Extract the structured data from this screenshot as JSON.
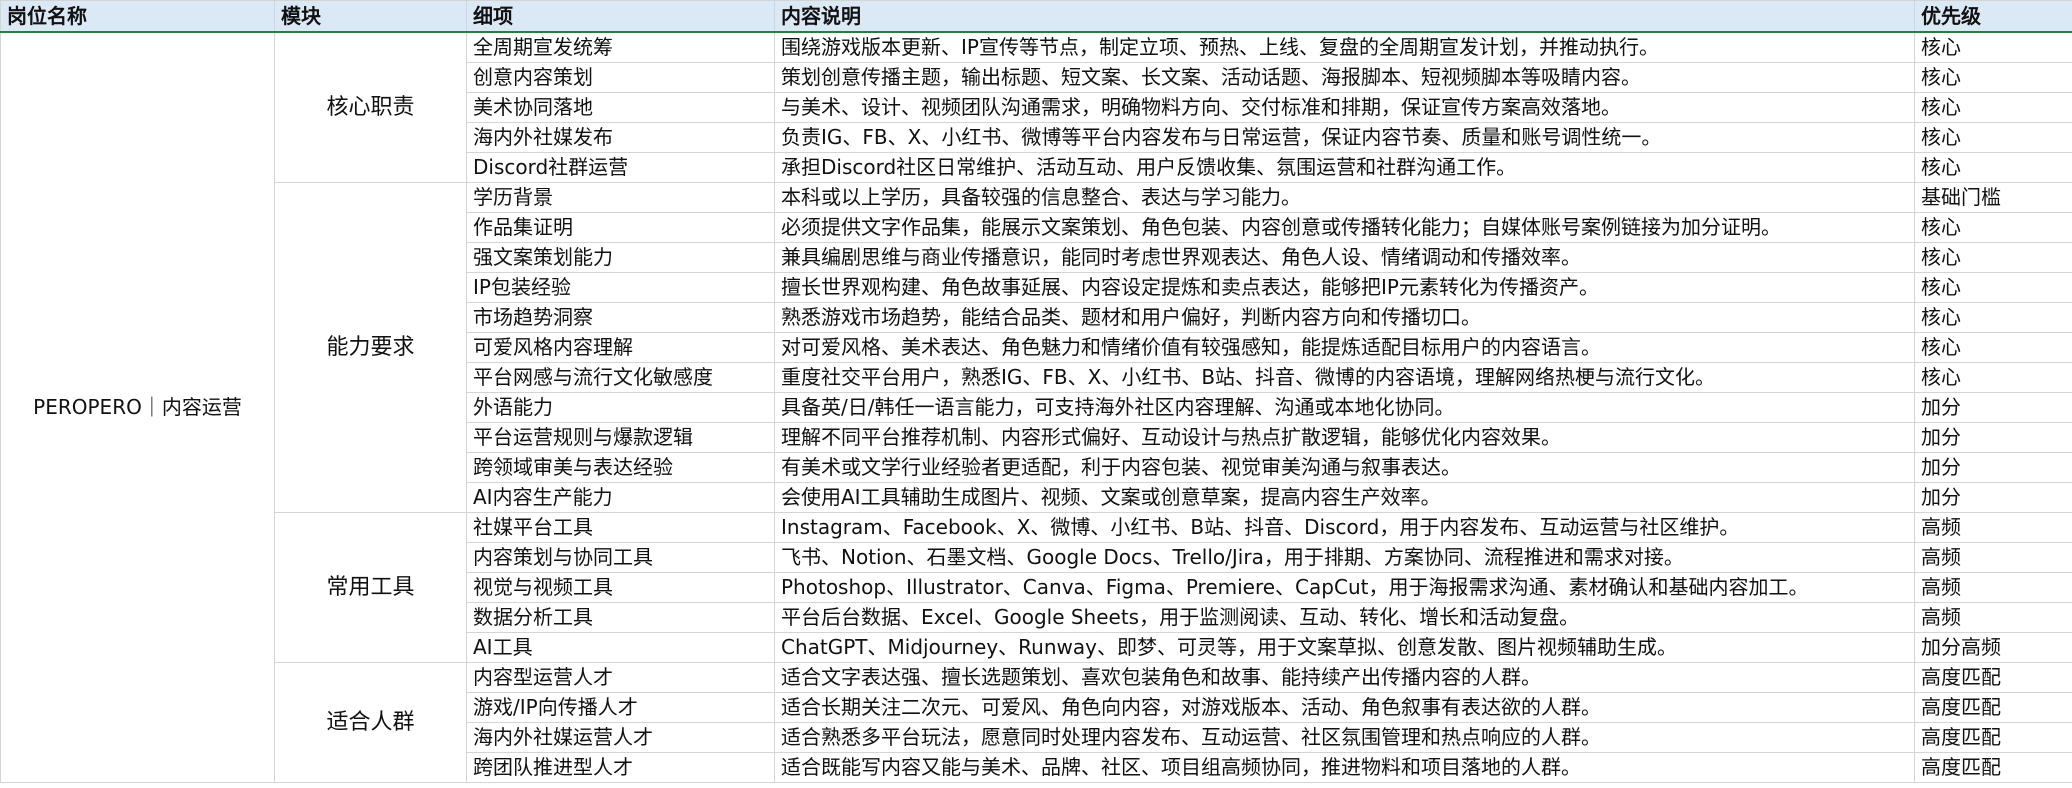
{
  "headers": [
    "岗位名称",
    "模块",
    "细项",
    "内容说明",
    "优先级"
  ],
  "position": "PEROPERO｜内容运营",
  "sections": [
    {
      "module": "核心职责",
      "rows": [
        {
          "item": "全周期宣发统筹",
          "desc": "围绕游戏版本更新、IP宣传等节点，制定立项、预热、上线、复盘的全周期宣发计划，并推动执行。",
          "priority": "核心"
        },
        {
          "item": "创意内容策划",
          "desc": "策划创意传播主题，输出标题、短文案、长文案、活动话题、海报脚本、短视频脚本等吸睛内容。",
          "priority": "核心"
        },
        {
          "item": "美术协同落地",
          "desc": "与美术、设计、视频团队沟通需求，明确物料方向、交付标准和排期，保证宣传方案高效落地。",
          "priority": "核心"
        },
        {
          "item": "海内外社媒发布",
          "desc": "负责IG、FB、X、小红书、微博等平台内容发布与日常运营，保证内容节奏、质量和账号调性统一。",
          "priority": "核心"
        },
        {
          "item": "Discord社群运营",
          "desc": "承担Discord社区日常维护、活动互动、用户反馈收集、氛围运营和社群沟通工作。",
          "priority": "核心"
        }
      ]
    },
    {
      "module": "能力要求",
      "rows": [
        {
          "item": "学历背景",
          "desc": "本科或以上学历，具备较强的信息整合、表达与学习能力。",
          "priority": "基础门槛"
        },
        {
          "item": "作品集证明",
          "desc": "必须提供文字作品集，能展示文案策划、角色包装、内容创意或传播转化能力；自媒体账号案例链接为加分证明。",
          "priority": "核心"
        },
        {
          "item": "强文案策划能力",
          "desc": "兼具编剧思维与商业传播意识，能同时考虑世界观表达、角色人设、情绪调动和传播效率。",
          "priority": "核心"
        },
        {
          "item": "IP包装经验",
          "desc": "擅长世界观构建、角色故事延展、内容设定提炼和卖点表达，能够把IP元素转化为传播资产。",
          "priority": "核心"
        },
        {
          "item": "市场趋势洞察",
          "desc": "熟悉游戏市场趋势，能结合品类、题材和用户偏好，判断内容方向和传播切口。",
          "priority": "核心"
        },
        {
          "item": "可爱风格内容理解",
          "desc": "对可爱风格、美术表达、角色魅力和情绪价值有较强感知，能提炼适配目标用户的内容语言。",
          "priority": "核心"
        },
        {
          "item": "平台网感与流行文化敏感度",
          "desc": "重度社交平台用户，熟悉IG、FB、X、小红书、B站、抖音、微博的内容语境，理解网络热梗与流行文化。",
          "priority": "核心"
        },
        {
          "item": "外语能力",
          "desc": "具备英/日/韩任一语言能力，可支持海外社区内容理解、沟通或本地化协同。",
          "priority": "加分"
        },
        {
          "item": "平台运营规则与爆款逻辑",
          "desc": "理解不同平台推荐机制、内容形式偏好、互动设计与热点扩散逻辑，能够优化内容效果。",
          "priority": "加分"
        },
        {
          "item": "跨领域审美与表达经验",
          "desc": "有美术或文学行业经验者更适配，利于内容包装、视觉审美沟通与叙事表达。",
          "priority": "加分"
        },
        {
          "item": "AI内容生产能力",
          "desc": "会使用AI工具辅助生成图片、视频、文案或创意草案，提高内容生产效率。",
          "priority": "加分"
        }
      ]
    },
    {
      "module": "常用工具",
      "rows": [
        {
          "item": "社媒平台工具",
          "desc": "Instagram、Facebook、X、微博、小红书、B站、抖音、Discord，用于内容发布、互动运营与社区维护。",
          "priority": "高频"
        },
        {
          "item": "内容策划与协同工具",
          "desc": "飞书、Notion、石墨文档、Google Docs、Trello/Jira，用于排期、方案协同、流程推进和需求对接。",
          "priority": "高频"
        },
        {
          "item": "视觉与视频工具",
          "desc": "Photoshop、Illustrator、Canva、Figma、Premiere、CapCut，用于海报需求沟通、素材确认和基础内容加工。",
          "priority": "高频"
        },
        {
          "item": "数据分析工具",
          "desc": "平台后台数据、Excel、Google Sheets，用于监测阅读、互动、转化、增长和活动复盘。",
          "priority": "高频"
        },
        {
          "item": "AI工具",
          "desc": "ChatGPT、Midjourney、Runway、即梦、可灵等，用于文案草拟、创意发散、图片视频辅助生成。",
          "priority": "加分高频"
        }
      ]
    },
    {
      "module": "适合人群",
      "rows": [
        {
          "item": "内容型运营人才",
          "desc": "适合文字表达强、擅长选题策划、喜欢包装角色和故事、能持续产出传播内容的人群。",
          "priority": "高度匹配"
        },
        {
          "item": "游戏/IP向传播人才",
          "desc": "适合长期关注二次元、可爱风、角色向内容，对游戏版本、活动、角色叙事有表达欲的人群。",
          "priority": "高度匹配"
        },
        {
          "item": "海内外社媒运营人才",
          "desc": "适合熟悉多平台玩法，愿意同时处理内容发布、互动运营、社区氛围管理和热点响应的人群。",
          "priority": "高度匹配"
        },
        {
          "item": "跨团队推进型人才",
          "desc": "适合既能写内容又能与美术、品牌、社区、项目组高频协同，推进物料和项目落地的人群。",
          "priority": "高度匹配"
        }
      ]
    }
  ]
}
